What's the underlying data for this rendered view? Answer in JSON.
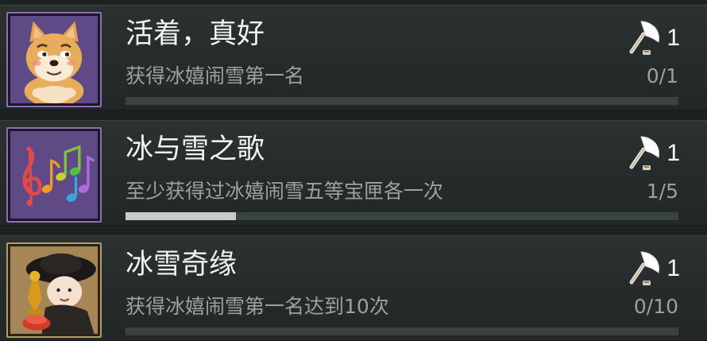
{
  "achievements": [
    {
      "title": "活着，真好",
      "description": "获得冰嬉闹雪第一名",
      "progress_text": "0/1",
      "progress_fraction": 0,
      "reward_icon": "axe-icon",
      "reward_count": "1",
      "badge_icon": "doge-face-icon",
      "frame_color": "#8d6fb5"
    },
    {
      "title": "冰与雪之歌",
      "description": "至少获得过冰嬉闹雪五等宝匣各一次",
      "progress_text": "1/5",
      "progress_fraction": 0.2,
      "reward_icon": "axe-icon",
      "reward_count": "1",
      "badge_icon": "music-notes-icon",
      "frame_color": "#8d6fb5"
    },
    {
      "title": "冰雪奇缘",
      "description": "获得冰嬉闹雪第一名达到10次",
      "progress_text": "0/10",
      "progress_fraction": 0,
      "reward_icon": "axe-icon",
      "reward_count": "1",
      "badge_icon": "trophy-character-icon",
      "frame_color": "#b79a62"
    }
  ]
}
